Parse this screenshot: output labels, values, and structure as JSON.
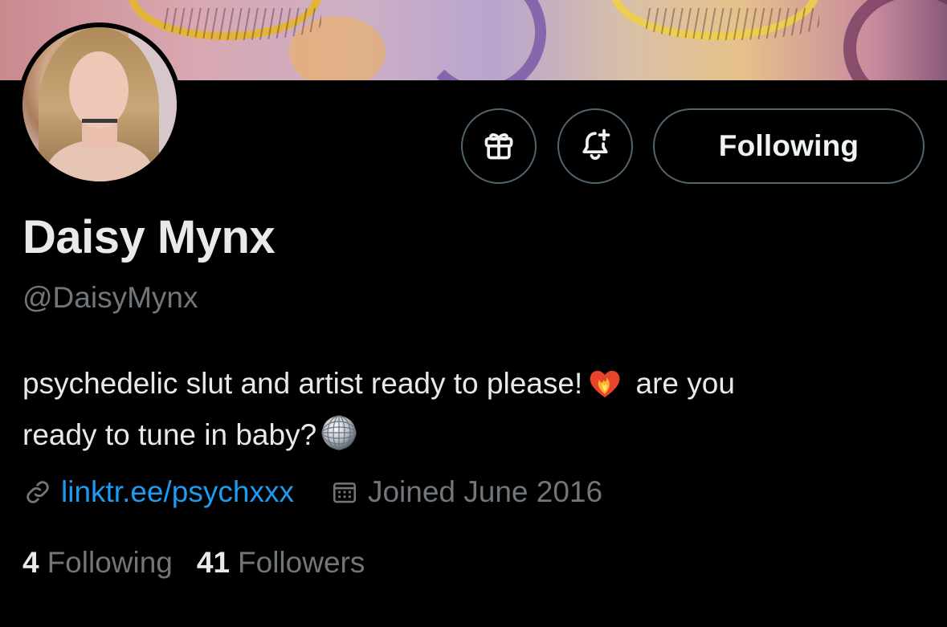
{
  "profile": {
    "display_name": "Daisy Mynx",
    "handle": "@DaisyMynx",
    "bio_line1": "psychedelic slut and artist ready to please!",
    "bio_line1_after": "are you",
    "bio_line2": "ready to tune in baby?",
    "website": "linktr.ee/psychxxx",
    "joined": "Joined June 2016"
  },
  "actions": {
    "gift_icon": "gift-icon",
    "notify_icon": "bell-plus-icon",
    "follow_label": "Following"
  },
  "stats": {
    "following_count": "4",
    "following_label": "Following",
    "followers_count": "41",
    "followers_label": "Followers"
  },
  "icons": {
    "link": "link-icon",
    "calendar": "calendar-icon",
    "bio_emoji_1": "burning-heart-emoji",
    "bio_emoji_2": "disco-ball-emoji"
  },
  "colors": {
    "background": "#000000",
    "text_primary": "#e7e9ea",
    "text_secondary": "#71767b",
    "link": "#1d9bf0",
    "button_border": "#536471"
  }
}
